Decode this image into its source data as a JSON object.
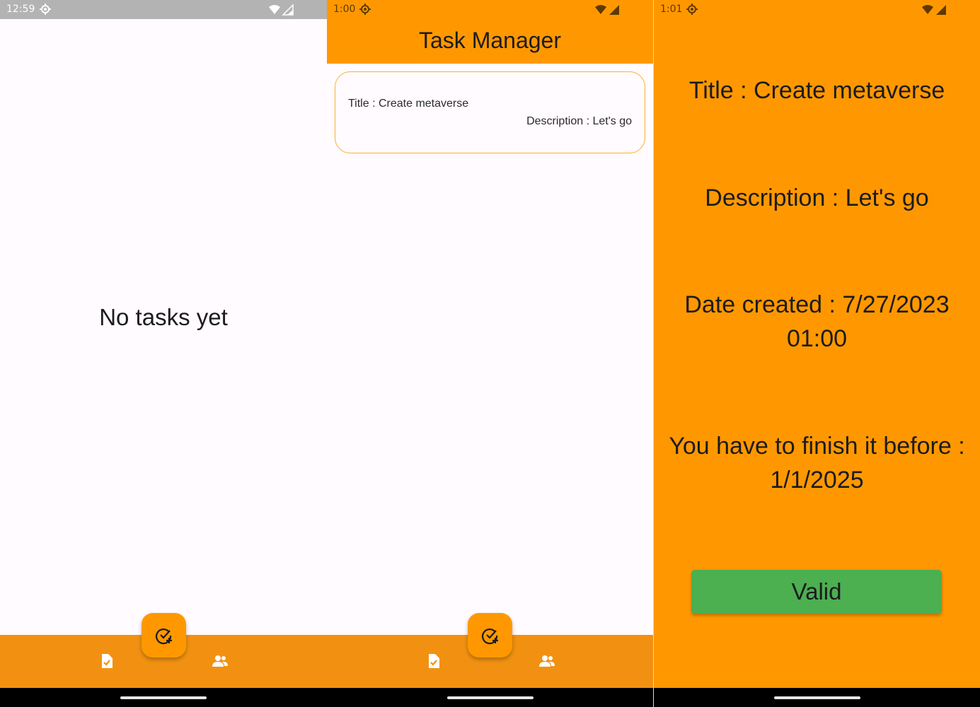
{
  "screens": [
    {
      "status_time": "12:59",
      "empty_message": "No tasks yet",
      "fab_icon": "add-task-icon",
      "nav_items": [
        {
          "icon": "task-list-icon"
        },
        {
          "icon": "people-icon"
        }
      ]
    },
    {
      "status_time": "1:00",
      "app_title": "Task Manager",
      "tasks": [
        {
          "title": "Title : Create metaverse",
          "description": "Description : Let's go"
        }
      ],
      "fab_icon": "add-task-icon",
      "nav_items": [
        {
          "icon": "task-list-icon"
        },
        {
          "icon": "people-icon"
        }
      ]
    },
    {
      "status_time": "1:01",
      "title": "Title : Create metaverse",
      "description": "Description : Let's go",
      "date_created_line1": "Date created : 7/27/2023",
      "date_created_line2": "01:00",
      "deadline_line1": "You have to finish it before :",
      "deadline_line2": "1/1/2025",
      "valid_label": "Valid"
    }
  ],
  "colors": {
    "primary": "#ff9800",
    "bottom_bar": "#f29111",
    "valid_button": "#4caf50",
    "background": "#fffbfe"
  }
}
